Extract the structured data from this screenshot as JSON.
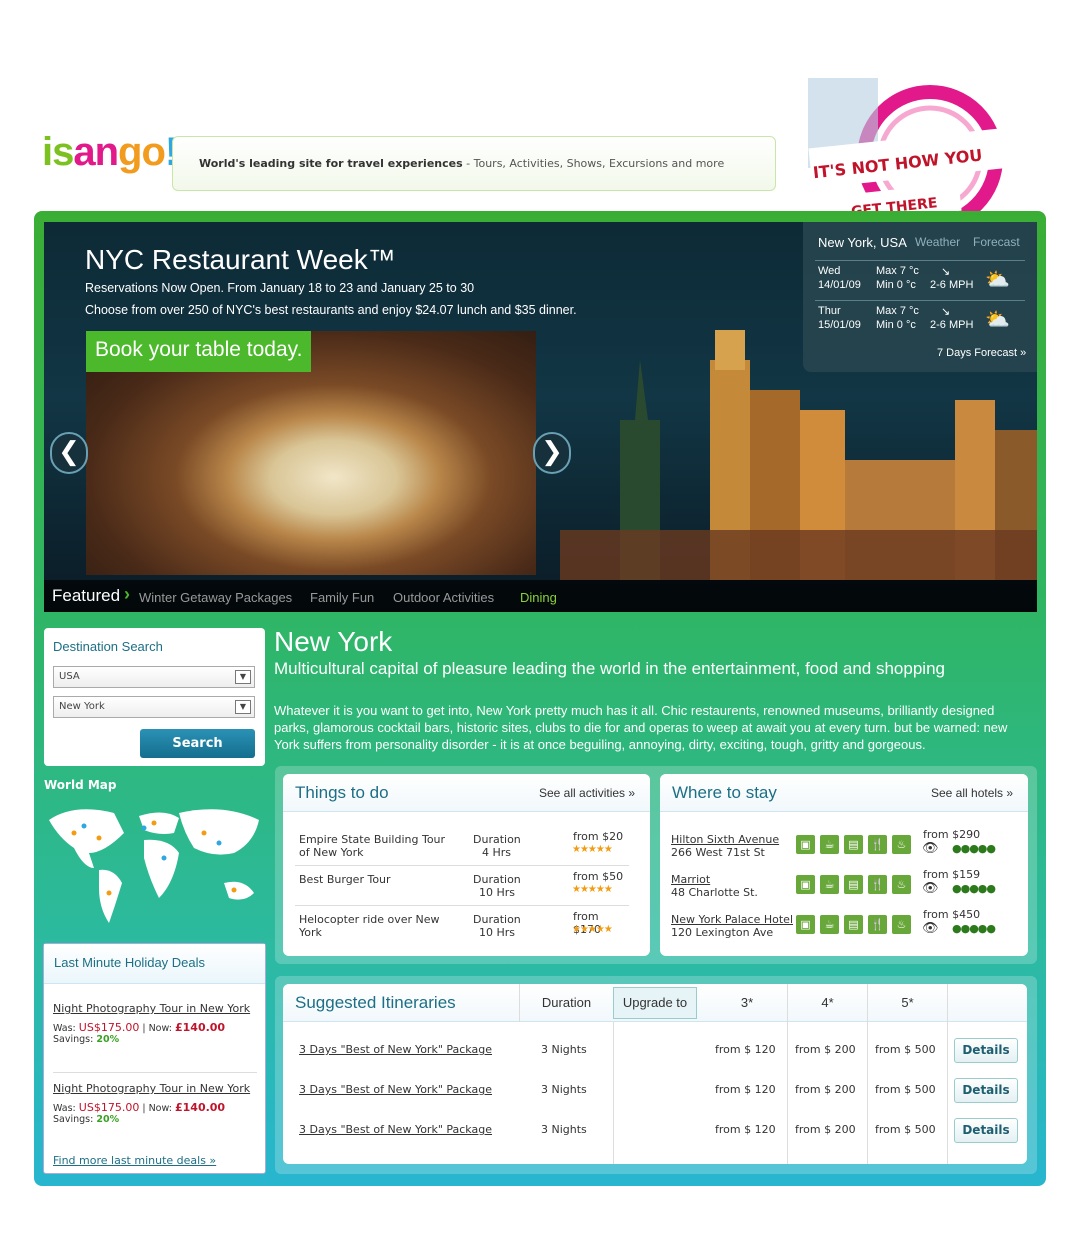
{
  "header": {
    "logo": {
      "p1": "is",
      "p2": "an",
      "p3": "go",
      "p4": "!"
    },
    "tagline_bold": "World's leading site for travel experiences",
    "tagline_rest": " - Tours, Activities, Shows, Excursions and more",
    "promo_line1": "IT'S NOT HOW YOU",
    "promo_line2": "GET THERE"
  },
  "hero": {
    "title": "NYC Restaurant Week™",
    "line1": "Reservations Now Open. From January 18 to 23 and January 25 to 30",
    "line2": "Choose from over 250 of NYC's best restaurants and enjoy $24.07 lunch and $35 dinner.",
    "cta": "Book your table today.",
    "prev": "❮",
    "next": "❯"
  },
  "weather": {
    "city": "New York, USA",
    "tab_weather": "Weather",
    "tab_forecast": "Forecast",
    "days": [
      {
        "day": "Wed",
        "date": "14/01/09",
        "max": "Max 7 °c",
        "min": "Min 0 °c",
        "wind": "2-6 MPH"
      },
      {
        "day": "Thur",
        "date": "15/01/09",
        "max": "Max 7 °c",
        "min": "Min 0 °c",
        "wind": "2-6 MPH"
      }
    ],
    "more": "7 Days Forecast »"
  },
  "featured": {
    "label": "Featured",
    "arrow": "›",
    "tabs": [
      "Winter Getaway Packages",
      "Family Fun",
      "Outdoor Activities",
      "Dining"
    ],
    "active_color": "#8bd13a"
  },
  "destination_search": {
    "title": "Destination Search",
    "country": "USA",
    "city": "New York",
    "button": "Search"
  },
  "world_map": {
    "title": "World Map"
  },
  "last_minute": {
    "title": "Last Minute Holiday Deals",
    "deals": [
      {
        "name": "Night Photography Tour in New York",
        "was_label": "Was:",
        "was": "US$175.00",
        "now_label": "| Now:",
        "now": "£140.00",
        "savings_label": "Savings:",
        "savings": "20%"
      },
      {
        "name": "Night Photography Tour in New York",
        "was_label": "Was:",
        "was": "US$175.00",
        "now_label": "| Now:",
        "now": "£140.00",
        "savings_label": "Savings:",
        "savings": "20%"
      }
    ],
    "more": "Find more last minute deals »"
  },
  "city": {
    "title": "New York",
    "subtitle": "Multicultural capital of pleasure leading the world in the entertainment, food and shopping",
    "description": "Whatever it is you want to get into, New York pretty much has it all. Chic restaurents, renowned museums, brilliantly designed parks, glamorous cocktail bars, historic sites, clubs to die for and operas to weep at await you at every turn. but be warned: new York suffers from personality disorder - it is at once beguiling, annoying, dirty, exciting, tough, gritty and gorgeous."
  },
  "things_to_do": {
    "title": "Things to do",
    "more": "See all activities »",
    "items": [
      {
        "name": "Empire State Building Tour of New York",
        "dur_label": "Duration",
        "duration": "4 Hrs",
        "price": "from $20",
        "stars": "★★★★★"
      },
      {
        "name": "Best Burger Tour",
        "dur_label": "Duration",
        "duration": "10 Hrs",
        "price": "from $50",
        "stars": "★★★★★"
      },
      {
        "name": "Helocopter ride over New York",
        "dur_label": "Duration",
        "duration": "10 Hrs",
        "price": "from $170",
        "stars": "★★★★★"
      }
    ]
  },
  "where_to_stay": {
    "title": "Where to stay",
    "more": "See all hotels »",
    "amenities": [
      "▣",
      "☕",
      "▤",
      "🍴",
      "♨"
    ],
    "hotels": [
      {
        "name": "Hilton Sixth Avenue",
        "address": "266 West 71st St",
        "price": "from $290",
        "rating": "●●●●●"
      },
      {
        "name": "Marriot",
        "address": "48 Charlotte St.",
        "price": "from $159",
        "rating": "●●●●●"
      },
      {
        "name": "New York Palace Hotel",
        "address": "120 Lexington Ave",
        "price": "from $450",
        "rating": "●●●●●"
      }
    ]
  },
  "itineraries": {
    "title": "Suggested Itineraries",
    "col_duration": "Duration",
    "upgrade": "Upgrade to",
    "col_3": "3*",
    "col_4": "4*",
    "col_5": "5*",
    "rows": [
      {
        "name": "3 Days \"Best of New York\" Package",
        "duration": "3 Nights",
        "p3": "from $ 120",
        "p4": "from $ 200",
        "p5": "from $ 500",
        "button": "Details"
      },
      {
        "name": "3 Days \"Best of New York\" Package",
        "duration": "3 Nights",
        "p3": "from $ 120",
        "p4": "from $ 200",
        "p5": "from $ 500",
        "button": "Details"
      },
      {
        "name": "3 Days \"Best of New York\" Package",
        "duration": "3 Nights",
        "p3": "from $ 120",
        "p4": "from $ 200",
        "p5": "from $ 500",
        "button": "Details"
      }
    ]
  }
}
